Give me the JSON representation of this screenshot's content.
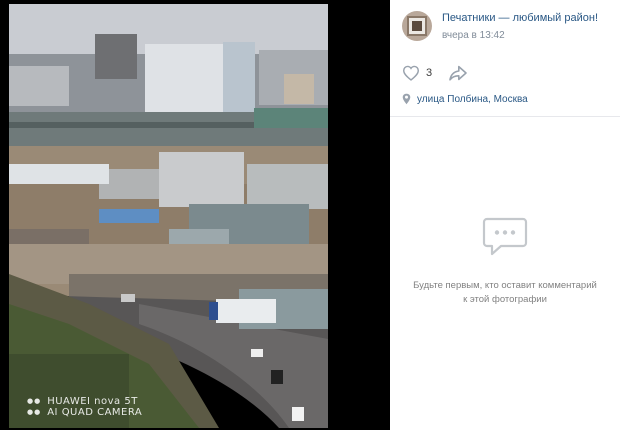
{
  "post": {
    "group_name": "Печатники — любимый район!",
    "date": "вчера в 13:42",
    "likes": "3",
    "location": "улица Полбина, Москва"
  },
  "photo": {
    "watermark_line1": "HUAWEI nova 5T",
    "watermark_line2": "AI QUAD CAMERA"
  },
  "comments": {
    "empty_text": "Будьте первым, кто оставит комментарий к этой фотографии"
  },
  "colors": {
    "link": "#2a5885",
    "muted": "#818c99",
    "icon": "#99a2ad",
    "empty_icon": "#c4c8cc"
  },
  "icons": {
    "like": "heart-icon",
    "share": "share-arrow-icon",
    "location": "location-pin-icon",
    "empty": "comment-bubble-icon"
  }
}
